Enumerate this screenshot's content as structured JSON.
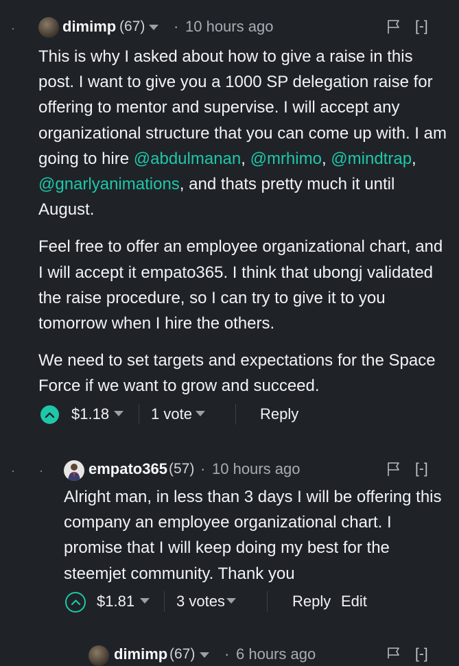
{
  "comments": [
    {
      "author": "dimimp",
      "reputation": "(67)",
      "separator": "·",
      "time": "10 hours ago",
      "collapse": "[-]",
      "body": {
        "p1_a": "This is why I asked about how to give a raise in this post. I want to give you a 1000 SP delegation raise for offering to mentor and supervise. I will accept any organizational structure that you can come up with. I am going to hire ",
        "mention1": "@abdulmanan",
        "sep1": ", ",
        "mention2": "@mrhimo",
        "sep2": ", ",
        "mention3": "@mindtrap",
        "sep3": ", ",
        "mention4": "@gnarlyanimations",
        "p1_b": ", and thats pretty much it until August.",
        "p2": "Feel free to offer an employee organizational chart, and I will accept it empato365. I think that ubongj validated the raise procedure, so I can try to give it to you tomorrow when I hire the others.",
        "p3": "We need to set targets and expectations for the Space Force if we want to grow and succeed."
      },
      "payout": "$1.18",
      "votes": "1 vote",
      "reply": "Reply"
    },
    {
      "author": "empato365",
      "reputation": "(57)",
      "separator": "·",
      "time": "10 hours ago",
      "collapse": "[-]",
      "body": {
        "p1": "Alright man, in less than 3 days I will be offering this company an employee organizational chart. I promise that I will keep doing my best for the steemjet community. Thank you"
      },
      "payout": "$1.81",
      "votes": "3 votes",
      "reply": "Reply",
      "edit": "Edit"
    },
    {
      "author": "dimimp",
      "reputation": "(67)",
      "separator": "·",
      "time": "6 hours ago",
      "collapse": "[-]"
    }
  ],
  "thread_dots": "·",
  "colors": {
    "background": "#1f2328",
    "accent": "#1fc7a9",
    "text": "#f2f3f5",
    "muted": "#a7adb4"
  },
  "icons": [
    "avatar",
    "chevron-down-icon",
    "flag-icon",
    "upvote-icon"
  ]
}
